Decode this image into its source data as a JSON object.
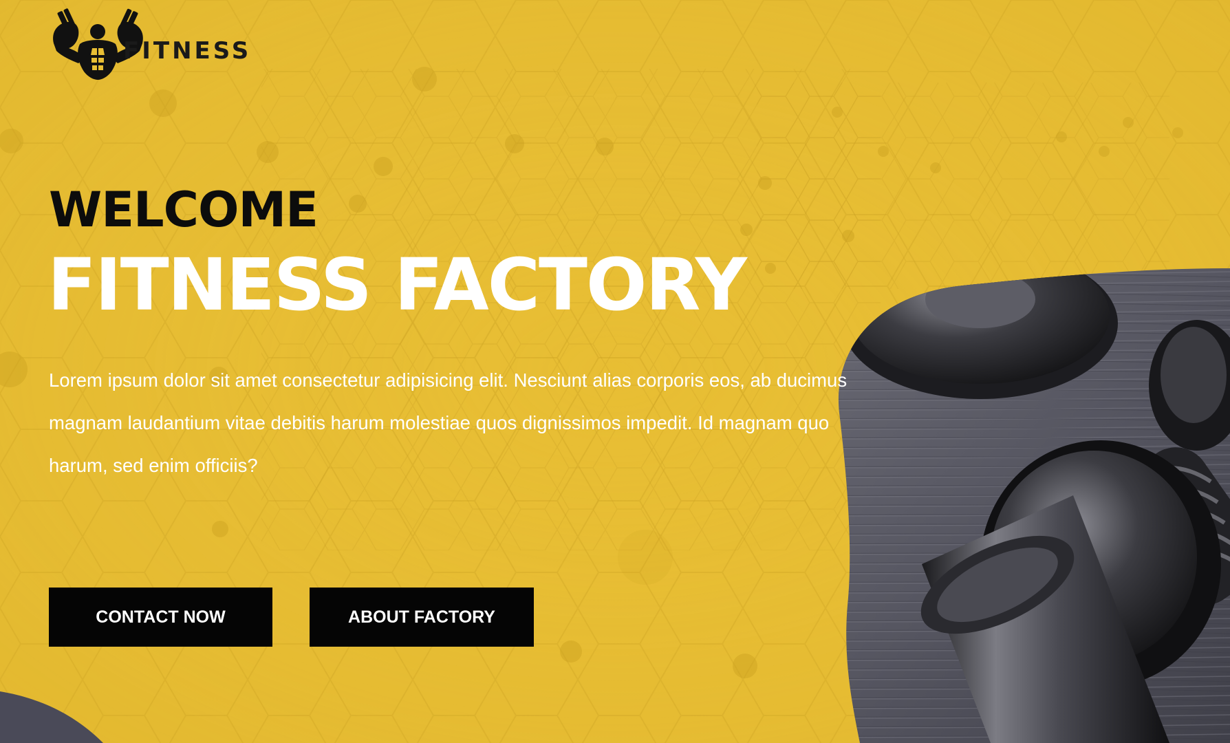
{
  "header": {
    "logo_text": "FITNESS",
    "logo_icon": "bodybuilder-dumbbell-icon"
  },
  "hero": {
    "welcome": "WELCOME",
    "title": "FITNESS FACTORY",
    "description": "Lorem ipsum dolor sit amet consectetur adipisicing elit. Nesciunt alias corporis eos, ab ducimus magnam laudantium vitae debitis harum molestiae quos dignissimos impedit. Id magnam quo harum, sed enim officiis?"
  },
  "buttons": {
    "contact_label": "CONTACT NOW",
    "about_label": "ABOUT FACTORY"
  },
  "colors": {
    "background": "#e8be34",
    "button": "#050505",
    "heading_dark": "#0c0c0c",
    "heading_light": "#ffffff"
  }
}
